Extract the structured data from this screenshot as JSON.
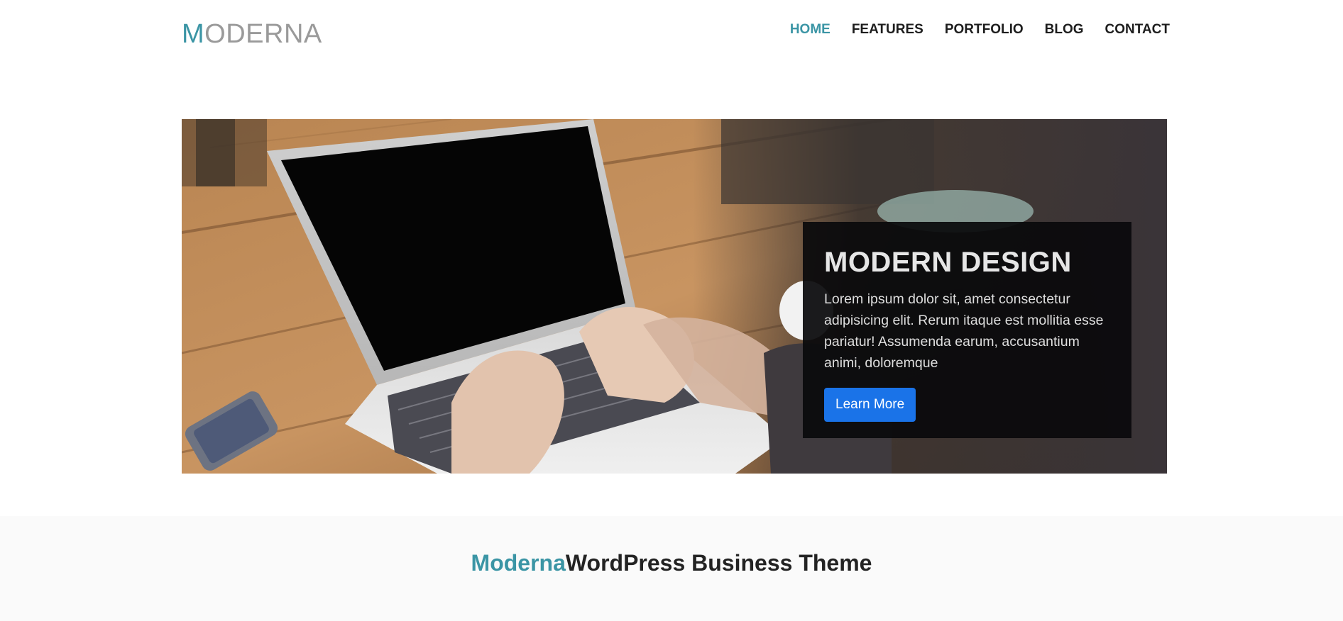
{
  "header": {
    "logo_first": "M",
    "logo_rest": "ODERNA",
    "nav": [
      "HOME",
      "FEATURES",
      "PORTFOLIO",
      "BLOG",
      "CONTACT"
    ]
  },
  "hero": {
    "title": "MODERN DESIGN",
    "text": "Lorem ipsum dolor sit, amet consectetur adipisicing elit. Rerum itaque est mollitia esse pariatur! Assumenda earum, accusantium animi, doloremque",
    "button": "Learn More"
  },
  "intro": {
    "accent": "Moderna",
    "rest": "WordPress Business Theme"
  },
  "colors": {
    "accent": "#3b95a5",
    "button": "#1a73e8"
  }
}
